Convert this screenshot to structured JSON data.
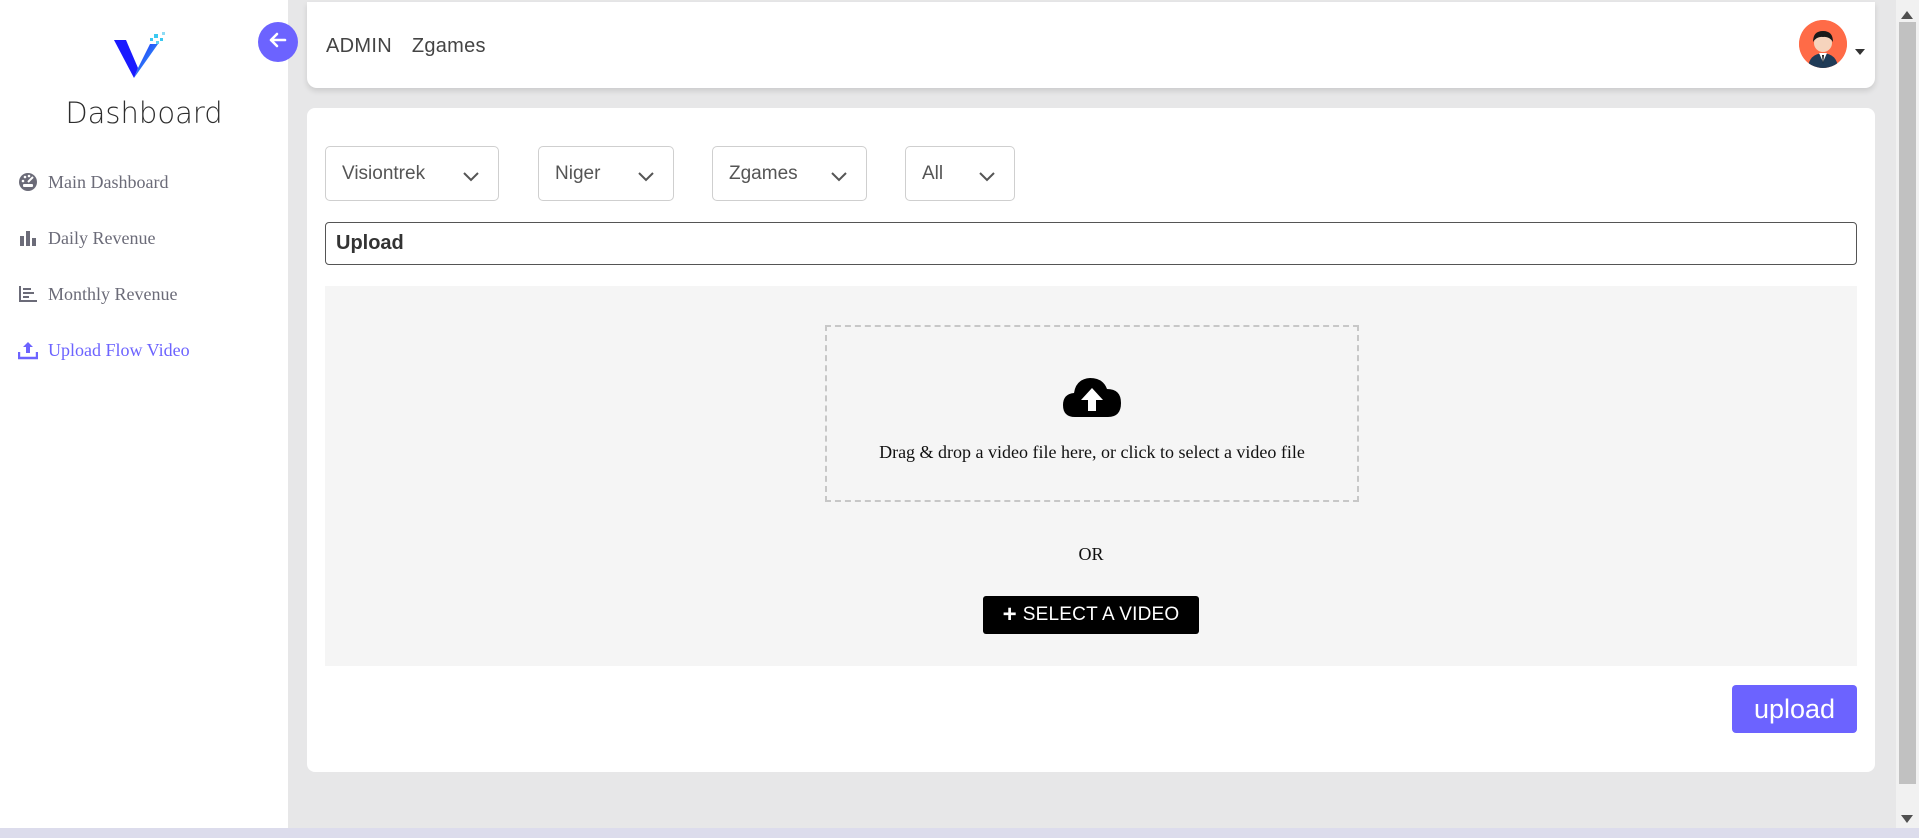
{
  "sidebar": {
    "brand": "Dashboard",
    "items": [
      {
        "label": "Main Dashboard",
        "icon": "dashboard-gauge-icon"
      },
      {
        "label": "Daily Revenue",
        "icon": "bar-chart-icon"
      },
      {
        "label": "Monthly Revenue",
        "icon": "line-chart-icon"
      },
      {
        "label": "Upload Flow Video",
        "icon": "upload-icon",
        "active": true
      }
    ]
  },
  "header": {
    "role": "ADMIN",
    "company": "Zgames"
  },
  "filters": {
    "operator": "Visiontrek",
    "country": "Niger",
    "service": "Zgames",
    "type": "All"
  },
  "upload": {
    "title": "Upload",
    "drop_text": "Drag & drop a video file here, or click to select a video file",
    "or_text": "OR",
    "select_label": "SELECT A VIDEO",
    "submit_label": "upload"
  },
  "colors": {
    "accent": "#6c63ff",
    "logo_dark": "#1a1aff",
    "logo_light": "#3cc8f0"
  }
}
